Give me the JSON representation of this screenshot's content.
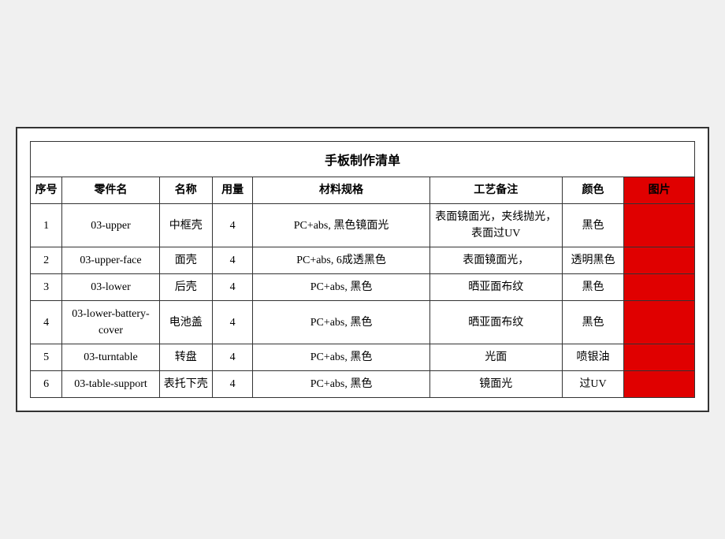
{
  "title": "手板制作清单",
  "headers": {
    "seq": "序号",
    "part": "零件名",
    "name": "名称",
    "qty": "用量",
    "spec": "材料规格",
    "process": "工艺备注",
    "color": "颜色",
    "img": "图片"
  },
  "rows": [
    {
      "seq": "1",
      "part": "03-upper",
      "name": "中框壳",
      "qty": "4",
      "spec": "PC+abs, 黑色镜面光",
      "process": "表面镜面光，夹线抛光，表面过UV",
      "color": "黑色",
      "img": ""
    },
    {
      "seq": "2",
      "part": "03-upper-face",
      "name": "面壳",
      "qty": "4",
      "spec": "PC+abs, 6成透黑色",
      "process": "表面镜面光，",
      "color": "透明黑色",
      "img": ""
    },
    {
      "seq": "3",
      "part": "03-lower",
      "name": "后壳",
      "qty": "4",
      "spec": "PC+abs, 黑色",
      "process": "晒亚面布纹",
      "color": "黑色",
      "img": ""
    },
    {
      "seq": "4",
      "part": "03-lower-battery-cover",
      "name": "电池盖",
      "qty": "4",
      "spec": "PC+abs, 黑色",
      "process": "晒亚面布纹",
      "color": "黑色",
      "img": ""
    },
    {
      "seq": "5",
      "part": "03-turntable",
      "name": "转盘",
      "qty": "4",
      "spec": "PC+abs, 黑色",
      "process": "光面",
      "color": "喷银油",
      "img": ""
    },
    {
      "seq": "6",
      "part": "03-table-support",
      "name": "表托下壳",
      "qty": "4",
      "spec": "PC+abs, 黑色",
      "process": "镜面光",
      "color": "过UV",
      "img": ""
    }
  ]
}
